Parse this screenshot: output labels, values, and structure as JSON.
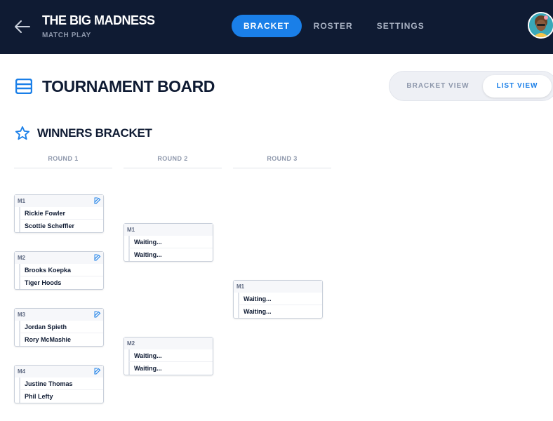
{
  "header": {
    "title": "THE BIG MADNESS",
    "subtitle": "MATCH PLAY",
    "tabs": [
      {
        "label": "BRACKET",
        "active": true
      },
      {
        "label": "ROSTER",
        "active": false
      },
      {
        "label": "SETTINGS",
        "active": false
      }
    ]
  },
  "board": {
    "title": "TOURNAMENT BOARD",
    "view_toggle": {
      "bracket_view": "BRACKET VIEW",
      "list_view": "LIST VIEW",
      "selected": "LIST VIEW"
    }
  },
  "section": {
    "title": "WINNERS BRACKET"
  },
  "rounds": [
    {
      "label": "ROUND 1",
      "matches": [
        {
          "label": "M1",
          "players": [
            "Rickie Fowler",
            "Scottie Scheffler"
          ],
          "editable": true
        },
        {
          "label": "M2",
          "players": [
            "Brooks Koepka",
            "Tiger Hoods"
          ],
          "editable": true
        },
        {
          "label": "M3",
          "players": [
            "Jordan Spieth",
            "Rory McMashie"
          ],
          "editable": true
        },
        {
          "label": "M4",
          "players": [
            "Justine Thomas",
            "Phil Lefty"
          ],
          "editable": true
        }
      ]
    },
    {
      "label": "ROUND 2",
      "matches": [
        {
          "label": "M1",
          "players": [
            "Waiting...",
            "Waiting..."
          ],
          "editable": false
        },
        {
          "label": "M2",
          "players": [
            "Waiting...",
            "Waiting..."
          ],
          "editable": false
        }
      ]
    },
    {
      "label": "ROUND 3",
      "matches": [
        {
          "label": "M1",
          "players": [
            "Waiting...",
            "Waiting..."
          ],
          "editable": false
        }
      ]
    }
  ],
  "colors": {
    "navy": "#0f1b33",
    "accent": "#1a7fe8",
    "muted": "#8d97ab"
  },
  "icons": {
    "back": "arrow-left-icon",
    "board": "list-icon",
    "section": "star-icon",
    "edit": "edit-icon"
  }
}
